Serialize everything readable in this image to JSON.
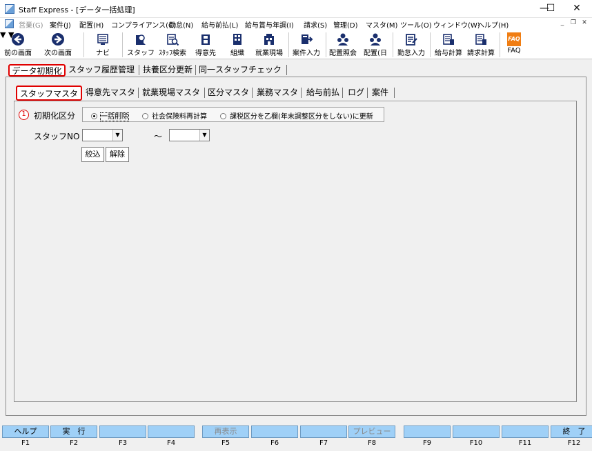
{
  "window": {
    "title": "Staff Express - [データ一括処理]",
    "minimize": "—",
    "maximize": "☐",
    "close": "✕"
  },
  "menu": {
    "items": [
      {
        "label": "営業(G)",
        "disabled": true
      },
      {
        "label": "案件(J)"
      },
      {
        "label": "配置(H)"
      },
      {
        "label": "コンプライアンス(C)"
      },
      {
        "label": "勤怠(N)"
      },
      {
        "label": "給与前払(L)"
      },
      {
        "label": "給与賞与年調(I)"
      },
      {
        "label": "請求(S)"
      },
      {
        "label": "管理(D)"
      },
      {
        "label": "マスタ(M)"
      },
      {
        "label": "ツール(O)"
      },
      {
        "label": "ウィンドウ(W)"
      },
      {
        "label": "ヘルプ(H)"
      }
    ],
    "mdi_min": "_",
    "mdi_restore": "❐",
    "mdi_close": "✕"
  },
  "toolbar": {
    "prev": "前の画面",
    "next": "次の画面",
    "navi": "ナビ",
    "staff": "スタッフ",
    "staff_search": "ｽﾀｯﾌ検索",
    "client": "得意先",
    "org": "組織",
    "worksite": "就業現場",
    "job_entry": "案件入力",
    "placement_query": "配置照会",
    "placement_day": "配置(日",
    "attendance": "勤怠入力",
    "payroll": "給与計算",
    "billing": "請求計算",
    "faq": "FAQ",
    "faq_icon_text": "FAQ"
  },
  "tabs_main": [
    {
      "label": "データ初期化",
      "active": true
    },
    {
      "label": "スタッフ履歴管理"
    },
    {
      "label": "扶養区分更新"
    },
    {
      "label": "同一スタッフチェック"
    }
  ],
  "tabs_sub": [
    {
      "label": "スタッフマスタ",
      "active": true
    },
    {
      "label": "得意先マスタ"
    },
    {
      "label": "就業現場マスタ"
    },
    {
      "label": "区分マスタ"
    },
    {
      "label": "業務マスタ"
    },
    {
      "label": "給与前払"
    },
    {
      "label": "ログ"
    },
    {
      "label": "案件"
    }
  ],
  "form": {
    "marker": "1",
    "init_label": "初期化区分",
    "options": [
      {
        "label": "一括削除",
        "selected": true
      },
      {
        "label": "社会保険料再計算"
      },
      {
        "label": "課税区分を乙欄(年末調整区分をしない)に更新"
      }
    ],
    "staff_no_label": "スタッフNO",
    "staff_no_from": "",
    "staff_no_to": "",
    "range_sep": "～",
    "filter_button": "絞込",
    "clear_button": "解除"
  },
  "fkeys": [
    {
      "label": "ヘルプ",
      "fn": "F1"
    },
    {
      "label": "実　行",
      "fn": "F2"
    },
    {
      "label": "",
      "fn": "F3"
    },
    {
      "label": "",
      "fn": "F4"
    },
    {
      "label": "再表示",
      "fn": "F5",
      "disabled": true
    },
    {
      "label": "",
      "fn": "F6"
    },
    {
      "label": "",
      "fn": "F7"
    },
    {
      "label": "プレビュー",
      "fn": "F8",
      "disabled": true
    },
    {
      "label": "",
      "fn": "F9"
    },
    {
      "label": "",
      "fn": "F10"
    },
    {
      "label": "",
      "fn": "F11"
    },
    {
      "label": "終　了",
      "fn": "F12"
    }
  ],
  "colors": {
    "accent_red": "#e00000",
    "fkey_blue": "#9fd0f7"
  }
}
